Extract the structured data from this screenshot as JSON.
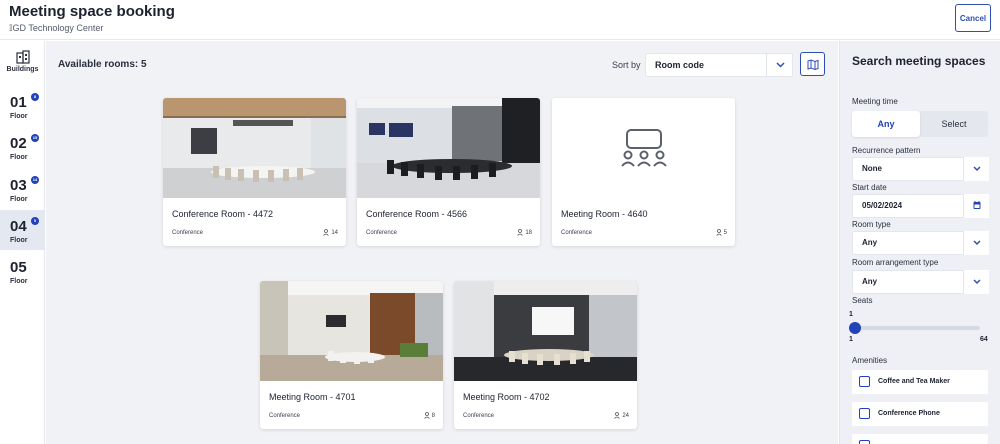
{
  "header": {
    "title": "Meeting space booking",
    "location": "GD Technology Center",
    "cancel_label": "Cancel"
  },
  "rail": {
    "buildings_label": "Buildings",
    "floors": [
      {
        "number": "01",
        "label": "Floor",
        "badge": "8"
      },
      {
        "number": "02",
        "label": "Floor",
        "badge": "15"
      },
      {
        "number": "03",
        "label": "Floor",
        "badge": "14"
      },
      {
        "number": "04",
        "label": "Floor",
        "badge": "5",
        "active": true
      },
      {
        "number": "05",
        "label": "Floor",
        "badge": ""
      }
    ]
  },
  "main": {
    "available_rooms": "Available rooms: 5",
    "sort_label": "Sort by",
    "sort_value": "Room code",
    "rooms": [
      {
        "name": "Conference Room - 4472",
        "type": "Conference",
        "capacity": "14",
        "image": "photo-conference-room"
      },
      {
        "name": "Conference Room - 4566",
        "type": "Conference",
        "capacity": "18",
        "image": "photo-boardroom"
      },
      {
        "name": "Meeting Room - 4640",
        "type": "Conference",
        "capacity": "5",
        "image": "meeting-placeholder-icon"
      },
      {
        "name": "Meeting Room - 4701",
        "type": "Conference",
        "capacity": "8",
        "image": "photo-wood-wall-room"
      },
      {
        "name": "Meeting Room - 4702",
        "type": "Conference",
        "capacity": "24",
        "image": "photo-dark-room"
      }
    ]
  },
  "panel": {
    "title": "Search meeting spaces",
    "meeting_time_label": "Meeting time",
    "meeting_time_options": [
      "Any",
      "Select"
    ],
    "meeting_time_selected": "Any",
    "recurrence_label": "Recurrence pattern",
    "recurrence_value": "None",
    "start_date_label": "Start date",
    "start_date_value": "05/02/2024",
    "room_type_label": "Room type",
    "room_type_value": "Any",
    "arrangement_label": "Room arrangement type",
    "arrangement_value": "Any",
    "seats_label": "Seats",
    "seats_value": "1",
    "seats_min": "1",
    "seats_max": "64",
    "amenities_label": "Amenities",
    "amenities": [
      "Coffee and Tea Maker",
      "Conference Phone"
    ]
  },
  "colors": {
    "accent": "#2142b8",
    "main_bg": "#f1f2f6",
    "panel_bg": "#eef0f5"
  }
}
